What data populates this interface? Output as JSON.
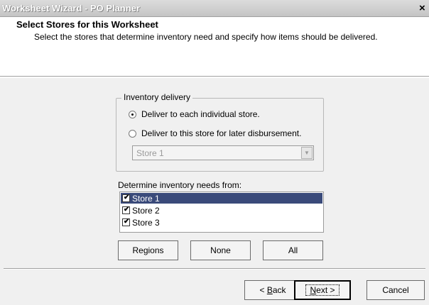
{
  "window": {
    "title": "Worksheet Wizard - PO Planner",
    "close_glyph": "×"
  },
  "header": {
    "title": "Select Stores for this Worksheet",
    "subtitle": "Select the stores that determine inventory need and specify how items should be delivered."
  },
  "delivery": {
    "legend": "Inventory delivery",
    "option_individual": "Deliver to each individual store.",
    "option_this_store": "Deliver to this store for later disbursement.",
    "selected_option": "individual",
    "store_select_value": "Store 1",
    "store_select_enabled": false
  },
  "stores": {
    "label": "Determine inventory needs from:",
    "items": [
      {
        "label": "Store 1",
        "checked": true,
        "selected": true
      },
      {
        "label": "Store 2",
        "checked": true,
        "selected": false
      },
      {
        "label": "Store 3",
        "checked": true,
        "selected": false
      }
    ],
    "buttons": {
      "regions": "Regions",
      "none": "None",
      "all": "All"
    }
  },
  "footer": {
    "back_prefix": "< ",
    "back_key": "B",
    "back_rest": "ack",
    "next_key": "N",
    "next_rest": "ext >",
    "cancel": "Cancel"
  },
  "colors": {
    "selection": "#3a4a7a",
    "dialog_background": "#f0f0f0"
  }
}
